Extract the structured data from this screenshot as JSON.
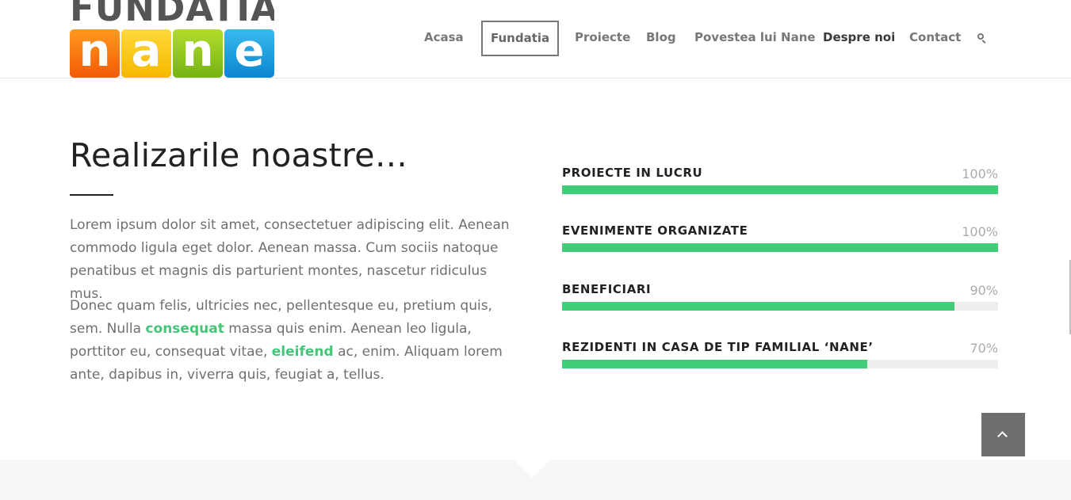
{
  "header": {
    "logo": {
      "top_text": "FUNDATIA",
      "tiles": [
        "n",
        "a",
        "n",
        "e"
      ]
    },
    "nav": [
      {
        "label": "Acasa"
      },
      {
        "label": "Fundatia"
      },
      {
        "label": "Proiecte"
      },
      {
        "label": "Blog"
      },
      {
        "label": "Povestea lui Nane"
      },
      {
        "label": "Despre noi"
      },
      {
        "label": "Contact"
      }
    ],
    "active_nav": "Fundatia",
    "search_icon": "search-icon"
  },
  "main": {
    "heading": "Realizarile noastre…",
    "paragraph1": "Lorem ipsum dolor sit amet, consectetuer adipiscing elit. Aenean commodo ligula eget dolor. Aenean massa. Cum sociis natoque penatibus et magnis dis parturient montes, nascetur ridiculus mus.",
    "paragraph2": {
      "part1": "Donec quam felis, ultricies nec, pellentesque eu, pretium quis, sem. Nulla ",
      "link1": "consequat",
      "part2": " massa quis enim. Aenean leo ligula, porttitor eu, consequat vitae, ",
      "link2": "eleifend",
      "part3": " ac, enim. Aliquam lorem ante, dapibus in, viverra quis, feugiat a, tellus."
    }
  },
  "progress_bars": [
    {
      "label": "PROIECTE IN LUCRU",
      "percent_text": "100%",
      "value": 100
    },
    {
      "label": "EVENIMENTE ORGANIZATE",
      "percent_text": "100%",
      "value": 100
    },
    {
      "label": "BENEFICIARI",
      "percent_text": "90%",
      "value": 90
    },
    {
      "label": "REZIDENTI IN CASA DE TIP FAMILIAL ‘NANE’",
      "percent_text": "70%",
      "value": 70
    }
  ],
  "colors": {
    "accent_green": "#41cc77",
    "link_green": "#45c57a",
    "scroll_button": "#6f6f6f"
  },
  "scroll_top_icon": "chevron-up-icon"
}
